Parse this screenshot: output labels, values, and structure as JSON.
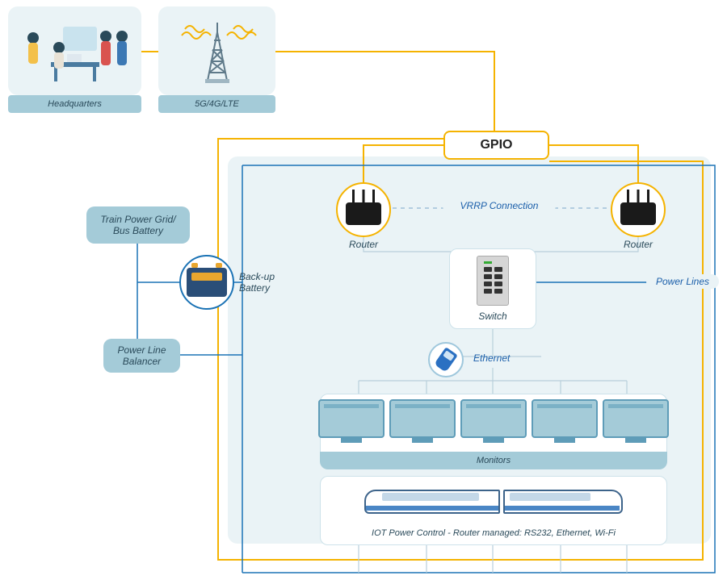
{
  "top": {
    "hq_caption": "Headquarters",
    "cell_caption": "5G/4G/LTE"
  },
  "gpio_label": "GPIO",
  "left": {
    "grid_label": "Train Power Grid/\nBus Battery",
    "battery_label": "Back-up\nBattery",
    "balancer_label": "Power Line\nBalancer"
  },
  "net": {
    "router_label": "Router",
    "vrrp_label": "VRRP Connection",
    "switch_label": "Switch",
    "ethernet_label": "Ethernet",
    "powerlines_label": "Power Lines"
  },
  "monitors_caption": "Monitors",
  "iot_caption": "IOT Power Control - Router managed: RS232, Ethernet, Wi-Fi"
}
